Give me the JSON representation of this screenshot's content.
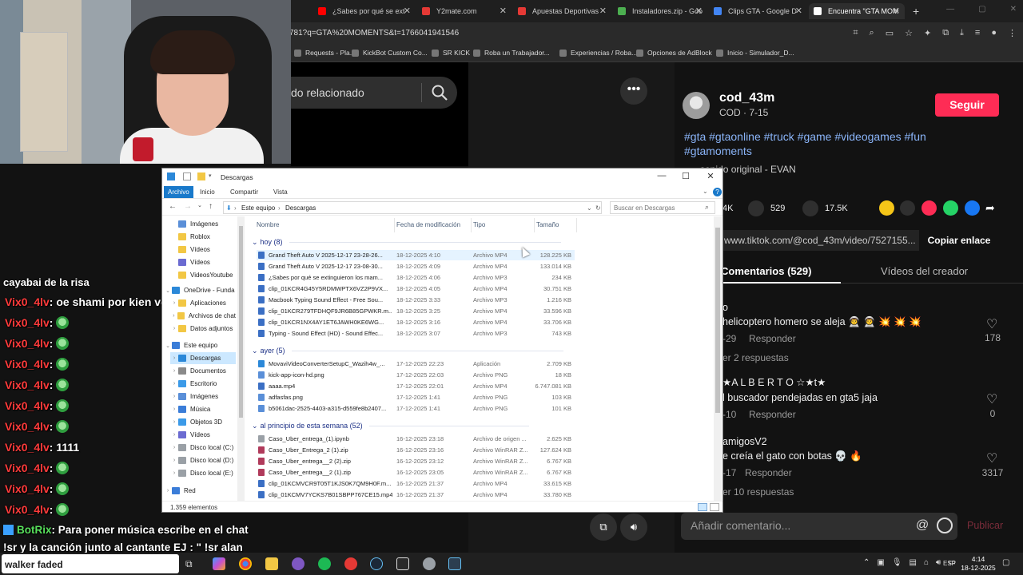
{
  "browser": {
    "tabs": [
      {
        "label": "",
        "color": "#9aa0a6"
      },
      {
        "label": "¿Sabes por qué se ext",
        "color": "#ff0000"
      },
      {
        "label": "Y2mate.com",
        "color": "#e53935"
      },
      {
        "label": "Apuestas Deportivas",
        "color": "#e53935"
      },
      {
        "label": "Instaladores.zip - Goo",
        "color": "#4caf50"
      },
      {
        "label": "Clips GTA - Google D",
        "color": "#4285f4"
      },
      {
        "label": "Encuentra \"GTA MOM",
        "color": "#ffffff"
      }
    ],
    "new_tab": "+",
    "url": "781?q=GTA%20MOMENTS&t=1766041941546",
    "bookmarks": [
      "Requests - Pla...",
      "KickBot Custom Co...",
      "SR KICK",
      "Roba un Trabajador...",
      "Experiencias / Roba...",
      "Opciones de AdBlock",
      "Inicio - Simulador_D..."
    ]
  },
  "tiktok": {
    "search_text": "do relacionado",
    "more": "•••",
    "username": "cod_43m",
    "user_sub": "COD · 7-15",
    "follow": "Seguir",
    "hashtags": "#gta #gtaonline #truck #game #videogames #fun #gtamoments",
    "sound": "sonido original - EVAN",
    "stat_likes": "4K",
    "stat_comments": "529",
    "stat_saves": "17.5K",
    "link": "www.tiktok.com/@cod_43m/video/7527155...",
    "copy_link": "Copiar enlace",
    "tab_comments": "Comentarios (529)",
    "tab_videos": "Vídeos del creador",
    "comments": [
      {
        "user": "o",
        "text": "helicoptero homero se aleja 👨‍🚀 👨‍🚀 💥 💥 💥",
        "date": "-29",
        "reply": "Responder",
        "replies": "er 2 respuestas",
        "likes": "178"
      },
      {
        "user": "★A L B E R T O ☆★t★",
        "text": "l buscador pendejadas en gta5 jaja",
        "date": "-10",
        "reply": "Responder",
        "replies": "",
        "likes": "0"
      },
      {
        "user": "amigosV2",
        "text": "e creía el gato con botas 💀 🔥",
        "date": "-17",
        "reply": "Responder",
        "replies": "er 10 respuestas",
        "likes": "3317"
      }
    ],
    "comment_placeholder": "Añadir comentario...",
    "publish": "Publicar"
  },
  "chat": {
    "top_line": "cayabai de la risa",
    "lines": [
      {
        "user": "Vix0_4lv",
        "text": ": oe shami por kien votaste",
        "emote": false
      },
      {
        "user": "Vix0_4lv",
        "text": ":",
        "emote": true
      },
      {
        "user": "Vix0_4lv",
        "text": ":",
        "emote": true
      },
      {
        "user": "Vix0_4lv",
        "text": ":",
        "emote": true
      },
      {
        "user": "Vix0_4lv",
        "text": ":",
        "emote": true
      },
      {
        "user": "Vix0_4lv",
        "text": ":",
        "emote": true
      },
      {
        "user": "Vix0_4lv",
        "text": ":",
        "emote": true
      },
      {
        "user": "Vix0_4lv",
        "text": ": 1111",
        "emote": false
      },
      {
        "user": "Vix0_4lv",
        "text": ":",
        "emote": true
      },
      {
        "user": "Vix0_4lv",
        "text": ":",
        "emote": true
      },
      {
        "user": "Vix0_4lv",
        "text": ":",
        "emote": true
      }
    ],
    "bot_user": "BotRix",
    "bot_text": ": Para poner música escribe en el chat",
    "bot_cont": "!sr y la canción junto al cantante EJ : \" !sr alan"
  },
  "explorer": {
    "title": "Descargas",
    "ribbon_tabs": [
      "Archivo",
      "Inicio",
      "Compartir",
      "Vista"
    ],
    "crumbs": [
      "Este equipo",
      "Descargas"
    ],
    "search_placeholder": "Buscar en Descargas",
    "columns": {
      "name": "Nombre",
      "date": "Fecha de modificación",
      "type": "Tipo",
      "size": "Tamaño"
    },
    "sidebar": [
      {
        "label": "Imágenes",
        "arrow": "",
        "indent": 1,
        "color": "#5a8fd8"
      },
      {
        "label": "Roblox",
        "arrow": "",
        "indent": 1,
        "color": "#f2c744"
      },
      {
        "label": "Vídeos",
        "arrow": "",
        "indent": 1,
        "color": "#f2c744"
      },
      {
        "label": "Vídeos",
        "arrow": "",
        "indent": 1,
        "color": "#6b6bd1"
      },
      {
        "label": "VideosYoutube",
        "arrow": "",
        "indent": 1,
        "color": "#f2c744"
      },
      {
        "label": "OneDrive - Funda",
        "arrow": "v",
        "indent": 0,
        "color": "#2b88d8"
      },
      {
        "label": "Aplicaciones",
        "arrow": ">",
        "indent": 1,
        "color": "#f2c744"
      },
      {
        "label": "Archivos de chat",
        "arrow": ">",
        "indent": 1,
        "color": "#f2c744"
      },
      {
        "label": "Datos adjuntos",
        "arrow": ">",
        "indent": 1,
        "color": "#f2c744"
      },
      {
        "label": "Este equipo",
        "arrow": "v",
        "indent": 0,
        "color": "#3b7dd8"
      },
      {
        "label": "Descargas",
        "arrow": ">",
        "indent": 1,
        "color": "#2b88d8"
      },
      {
        "label": "Documentos",
        "arrow": ">",
        "indent": 1,
        "color": "#8a8a8a"
      },
      {
        "label": "Escritorio",
        "arrow": ">",
        "indent": 1,
        "color": "#3b9ae8"
      },
      {
        "label": "Imágenes",
        "arrow": ">",
        "indent": 1,
        "color": "#5a8fd8"
      },
      {
        "label": "Música",
        "arrow": ">",
        "indent": 1,
        "color": "#3b7dd8"
      },
      {
        "label": "Objetos 3D",
        "arrow": ">",
        "indent": 1,
        "color": "#3b9ae8"
      },
      {
        "label": "Vídeos",
        "arrow": ">",
        "indent": 1,
        "color": "#6b6bd1"
      },
      {
        "label": "Disco local (C:)",
        "arrow": ">",
        "indent": 1,
        "color": "#9aa0a6"
      },
      {
        "label": "Disco local (D:)",
        "arrow": ">",
        "indent": 1,
        "color": "#9aa0a6"
      },
      {
        "label": "Disco local (E:)",
        "arrow": ">",
        "indent": 1,
        "color": "#9aa0a6"
      },
      {
        "label": "Red",
        "arrow": ">",
        "indent": 0,
        "color": "#3b7dd8"
      }
    ],
    "groups": [
      {
        "label": "hoy (8)",
        "files": [
          {
            "name": "Grand Theft Auto V 2025-12-17 23-28-26...",
            "date": "18-12-2025 4:10",
            "type": "Archivo MP4",
            "size": "128.225 KB",
            "color": "#3b6fc4"
          },
          {
            "name": "Grand Theft Auto V 2025-12-17 23-08-30...",
            "date": "18-12-2025 4:09",
            "type": "Archivo MP4",
            "size": "133.014 KB",
            "color": "#3b6fc4"
          },
          {
            "name": "¿Sabes por qué se extinguieron los mam...",
            "date": "18-12-2025 4:06",
            "type": "Archivo MP3",
            "size": "234 KB",
            "color": "#3b6fc4"
          },
          {
            "name": "clip_01KCR4G45Y5RDMWPTX6VZ2P9VX...",
            "date": "18-12-2025 4:05",
            "type": "Archivo MP4",
            "size": "30.751 KB",
            "color": "#3b6fc4"
          },
          {
            "name": "Macbook Typing Sound Effect - Free Sou...",
            "date": "18-12-2025 3:33",
            "type": "Archivo MP3",
            "size": "1.216 KB",
            "color": "#3b6fc4"
          },
          {
            "name": "clip_01KCR279TFDHQF9JR6B85GPWKR.m...",
            "date": "18-12-2025 3:25",
            "type": "Archivo MP4",
            "size": "33.596 KB",
            "color": "#3b6fc4"
          },
          {
            "name": "clip_01KCR1NX4AY1ET6JAWH0KE6WG...",
            "date": "18-12-2025 3:16",
            "type": "Archivo MP4",
            "size": "33.706 KB",
            "color": "#3b6fc4"
          },
          {
            "name": "Typing - Sound Effect (HD) - Sound Effec...",
            "date": "18-12-2025 3:07",
            "type": "Archivo MP3",
            "size": "743 KB",
            "color": "#3b6fc4"
          }
        ]
      },
      {
        "label": "ayer (5)",
        "files": [
          {
            "name": "MovaviVideoConverterSetupC_Wazih4w_...",
            "date": "17-12-2025 22:23",
            "type": "Aplicación",
            "size": "2.709 KB",
            "color": "#2b88d8"
          },
          {
            "name": "kick-app-icon-hd.png",
            "date": "17-12-2025 22:03",
            "type": "Archivo PNG",
            "size": "18 KB",
            "color": "#5a8fd8"
          },
          {
            "name": "aaaa.mp4",
            "date": "17-12-2025 22:01",
            "type": "Archivo MP4",
            "size": "6.747.081 KB",
            "color": "#3b6fc4"
          },
          {
            "name": "adfasfas.png",
            "date": "17-12-2025 1:41",
            "type": "Archivo PNG",
            "size": "103 KB",
            "color": "#5a8fd8"
          },
          {
            "name": "b5061dac-2525-4403-a315-d559fe8b2407...",
            "date": "17-12-2025 1:41",
            "type": "Archivo PNG",
            "size": "101 KB",
            "color": "#5a8fd8"
          }
        ]
      },
      {
        "label": "al principio de esta semana (52)",
        "files": [
          {
            "name": "Caso_Uber_entrega_(1).ipynb",
            "date": "16-12-2025 23:18",
            "type": "Archivo de origen ...",
            "size": "2.625 KB",
            "color": "#9aa0a6"
          },
          {
            "name": "Caso_Uber_Entrega_2 (1).zip",
            "date": "16-12-2025 23:16",
            "type": "Archivo WinRAR Z...",
            "size": "127.624 KB",
            "color": "#b03a5b"
          },
          {
            "name": "Caso_Uber_entrega__2 (2).zip",
            "date": "16-12-2025 23:12",
            "type": "Archivo WinRAR Z...",
            "size": "6.767 KB",
            "color": "#b03a5b"
          },
          {
            "name": "Caso_Uber_entrega__2 (1).zip",
            "date": "16-12-2025 23:05",
            "type": "Archivo WinRAR Z...",
            "size": "6.767 KB",
            "color": "#b03a5b"
          },
          {
            "name": "clip_01KCMVCR9T05T1KJS0K7QM9H0F.m...",
            "date": "16-12-2025 21:37",
            "type": "Archivo MP4",
            "size": "33.615 KB",
            "color": "#3b6fc4"
          },
          {
            "name": "clip_01KCMV7YCKS7B01SBPP767CE15.mp4",
            "date": "16-12-2025 21:37",
            "type": "Archivo MP4",
            "size": "33.780 KB",
            "color": "#3b6fc4"
          }
        ]
      }
    ],
    "item_count": "1.359 elementos"
  },
  "taskbar": {
    "search_text": "walker faded",
    "lang": "ESP",
    "time": "4:14",
    "date": "18-12-2025"
  }
}
